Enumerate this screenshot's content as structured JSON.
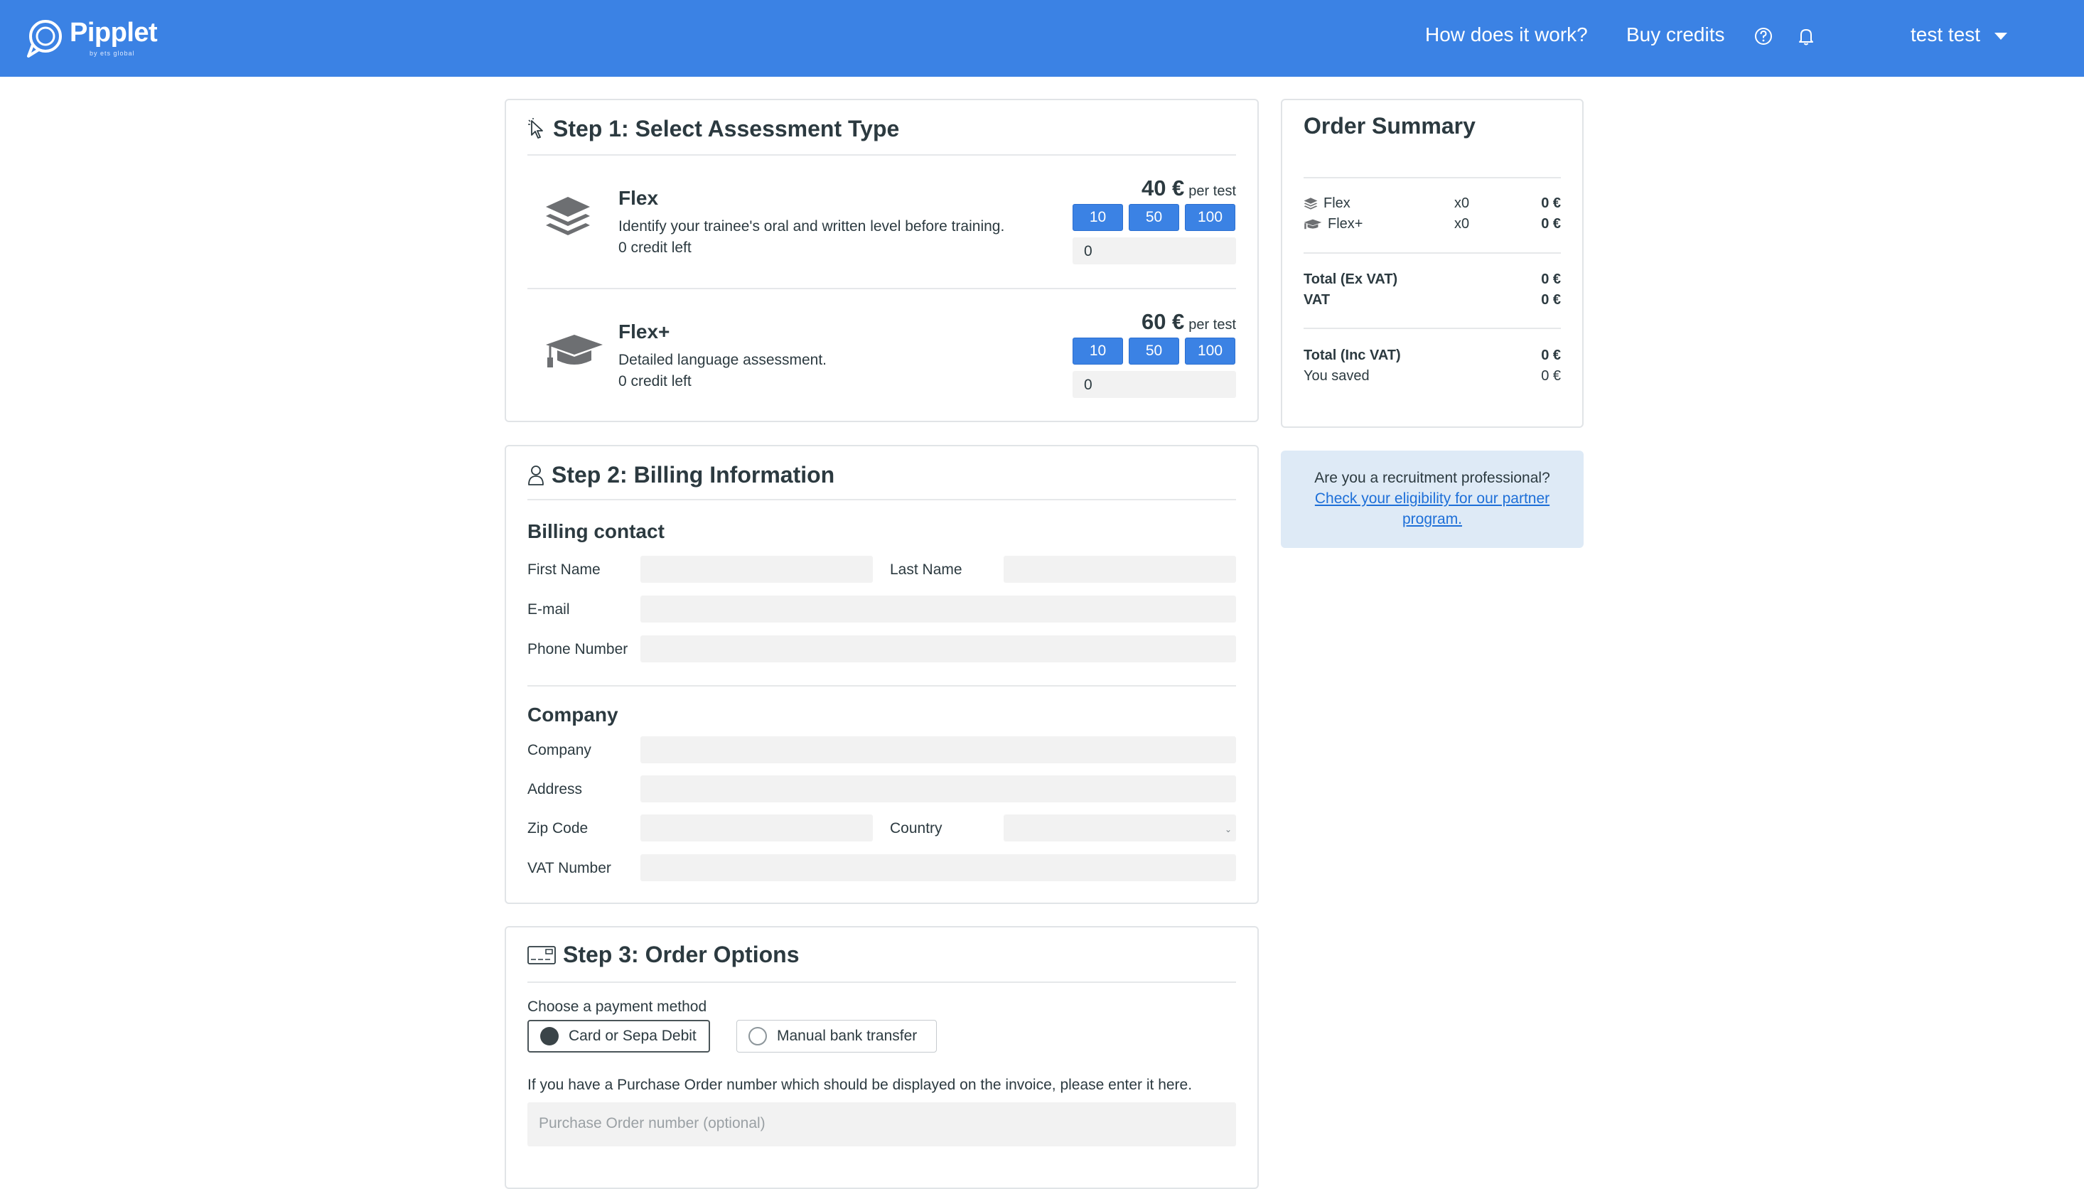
{
  "header": {
    "logo_text": "Pipplet",
    "logo_sub": "by ets global",
    "nav": [
      "How does it work?",
      "Buy credits"
    ],
    "help_icon": "help-circle-icon",
    "bell_icon": "bell-icon",
    "user_name": "test test"
  },
  "step1": {
    "title": "Step 1: Select Assessment Type",
    "products": [
      {
        "name": "Flex",
        "icon": "layers-icon",
        "description": "Identify your trainee's oral and written level before training.",
        "credits": "0 credit left",
        "price": "40 €",
        "per": "per test",
        "quick_qty": [
          "10",
          "50",
          "100"
        ],
        "quantity": "0"
      },
      {
        "name": "Flex+",
        "icon": "graduation-cap-icon",
        "description": "Detailed language assessment.",
        "credits": "0 credit left",
        "price": "60 €",
        "per": "per test",
        "quick_qty": [
          "10",
          "50",
          "100"
        ],
        "quantity": "0"
      }
    ]
  },
  "step2": {
    "title": "Step 2: Billing Information",
    "billing_contact": "Billing contact",
    "first_name": "First Name",
    "last_name": "Last Name",
    "email": "E-mail",
    "phone": "Phone Number",
    "company_section": "Company",
    "company": "Company",
    "address": "Address",
    "zip": "Zip Code",
    "country": "Country",
    "vat_number": "VAT Number"
  },
  "step3": {
    "title": "Step 3: Order Options",
    "payment_label": "Choose a payment method",
    "methods": [
      {
        "label": "Card or Sepa Debit",
        "selected": true
      },
      {
        "label": "Manual bank transfer",
        "selected": false
      }
    ],
    "po_hint": "If you have a Purchase Order number which should be displayed on the invoice, please enter it here.",
    "po_placeholder": "Purchase Order number (optional)"
  },
  "summary": {
    "title": "Order Summary",
    "items": [
      {
        "name": "Flex",
        "qty": "x0",
        "amount": "0 €"
      },
      {
        "name": "Flex+",
        "qty": "x0",
        "amount": "0 €"
      }
    ],
    "total_ex_vat_label": "Total (Ex VAT)",
    "total_ex_vat": "0 €",
    "vat_label": "VAT",
    "vat": "0 €",
    "total_inc_vat_label": "Total (Inc VAT)",
    "total_inc_vat": "0 €",
    "saved_label": "You saved",
    "saved": "0 €"
  },
  "partner": {
    "question": "Are you a recruitment professional?",
    "link": "Check your eligibility for our partner program."
  },
  "colors": {
    "brand": "#3b82e4",
    "partner_bg": "#deeaf6",
    "link": "#1d6fd8"
  }
}
